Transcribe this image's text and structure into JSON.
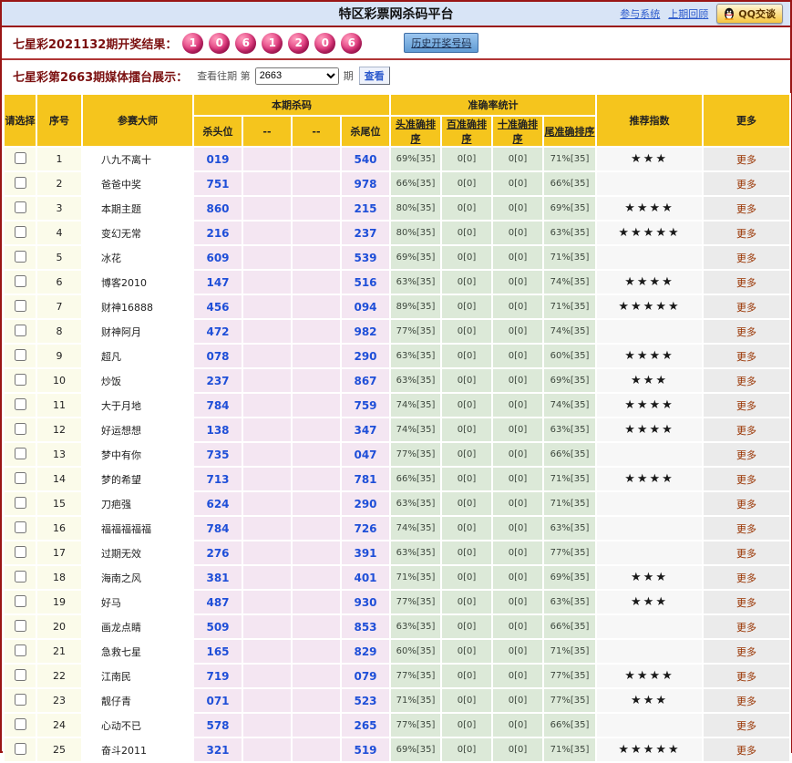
{
  "header": {
    "title": "特区彩票网杀码平台",
    "links": [
      "参与系统",
      "上期回顾"
    ],
    "qq_button_label": "QQ交谈"
  },
  "result_bar": {
    "label": "七星彩2021132期开奖结果：",
    "balls": [
      "1",
      "0",
      "6",
      "1",
      "2",
      "0",
      "6"
    ],
    "history_link": "历史开奖号码"
  },
  "picker_bar": {
    "label": "七星彩第2663期媒体擂台展示：",
    "hint": "查看往期 第",
    "selected_period": "2663",
    "suffix": "期",
    "view_button": "查看"
  },
  "table": {
    "group_headers": {
      "select": "请选择",
      "index": "序号",
      "master": "参赛大师",
      "kill": "本期杀码",
      "accuracy": "准确率统计",
      "stars": "推荐指数",
      "more": "更多"
    },
    "kill_subheaders": [
      "杀头位",
      "--",
      "--",
      "杀尾位"
    ],
    "accuracy_subheaders": [
      "头准确排序",
      "百准确排序",
      "十准确排序",
      "尾准确排序"
    ],
    "more_label": "更多",
    "star_glyph": "★",
    "rows": [
      {
        "index": 1,
        "master": "八九不离十",
        "head": "019",
        "tail": "540",
        "acc": [
          "69%[35]",
          "0[0]",
          "0[0]",
          "71%[35]"
        ],
        "stars": 3
      },
      {
        "index": 2,
        "master": "爸爸中奖",
        "head": "751",
        "tail": "978",
        "acc": [
          "66%[35]",
          "0[0]",
          "0[0]",
          "66%[35]"
        ],
        "stars": 0
      },
      {
        "index": 3,
        "master": "本期主题",
        "head": "860",
        "tail": "215",
        "acc": [
          "80%[35]",
          "0[0]",
          "0[0]",
          "69%[35]"
        ],
        "stars": 4
      },
      {
        "index": 4,
        "master": "变幻无常",
        "head": "216",
        "tail": "237",
        "acc": [
          "80%[35]",
          "0[0]",
          "0[0]",
          "63%[35]"
        ],
        "stars": 5
      },
      {
        "index": 5,
        "master": "冰花",
        "head": "609",
        "tail": "539",
        "acc": [
          "69%[35]",
          "0[0]",
          "0[0]",
          "71%[35]"
        ],
        "stars": 0
      },
      {
        "index": 6,
        "master": "博客2010",
        "head": "147",
        "tail": "516",
        "acc": [
          "63%[35]",
          "0[0]",
          "0[0]",
          "74%[35]"
        ],
        "stars": 4
      },
      {
        "index": 7,
        "master": "财神16888",
        "head": "456",
        "tail": "094",
        "acc": [
          "89%[35]",
          "0[0]",
          "0[0]",
          "71%[35]"
        ],
        "stars": 5
      },
      {
        "index": 8,
        "master": "财神阿月",
        "head": "472",
        "tail": "982",
        "acc": [
          "77%[35]",
          "0[0]",
          "0[0]",
          "74%[35]"
        ],
        "stars": 0
      },
      {
        "index": 9,
        "master": "超凡",
        "head": "078",
        "tail": "290",
        "acc": [
          "63%[35]",
          "0[0]",
          "0[0]",
          "60%[35]"
        ],
        "stars": 4
      },
      {
        "index": 10,
        "master": "炒饭",
        "head": "237",
        "tail": "867",
        "acc": [
          "63%[35]",
          "0[0]",
          "0[0]",
          "69%[35]"
        ],
        "stars": 3
      },
      {
        "index": 11,
        "master": "大于月地",
        "head": "784",
        "tail": "759",
        "acc": [
          "74%[35]",
          "0[0]",
          "0[0]",
          "74%[35]"
        ],
        "stars": 4
      },
      {
        "index": 12,
        "master": "好运想想",
        "head": "138",
        "tail": "347",
        "acc": [
          "74%[35]",
          "0[0]",
          "0[0]",
          "63%[35]"
        ],
        "stars": 4
      },
      {
        "index": 13,
        "master": "梦中有你",
        "head": "735",
        "tail": "047",
        "acc": [
          "77%[35]",
          "0[0]",
          "0[0]",
          "66%[35]"
        ],
        "stars": 0
      },
      {
        "index": 14,
        "master": "梦的希望",
        "head": "713",
        "tail": "781",
        "acc": [
          "66%[35]",
          "0[0]",
          "0[0]",
          "71%[35]"
        ],
        "stars": 4
      },
      {
        "index": 15,
        "master": "刀疤强",
        "head": "624",
        "tail": "290",
        "acc": [
          "63%[35]",
          "0[0]",
          "0[0]",
          "71%[35]"
        ],
        "stars": 0
      },
      {
        "index": 16,
        "master": "福福福福福",
        "head": "784",
        "tail": "726",
        "acc": [
          "74%[35]",
          "0[0]",
          "0[0]",
          "63%[35]"
        ],
        "stars": 0
      },
      {
        "index": 17,
        "master": "过期无效",
        "head": "276",
        "tail": "391",
        "acc": [
          "63%[35]",
          "0[0]",
          "0[0]",
          "77%[35]"
        ],
        "stars": 0
      },
      {
        "index": 18,
        "master": "海南之风",
        "head": "381",
        "tail": "401",
        "acc": [
          "71%[35]",
          "0[0]",
          "0[0]",
          "69%[35]"
        ],
        "stars": 3
      },
      {
        "index": 19,
        "master": "好马",
        "head": "487",
        "tail": "930",
        "acc": [
          "77%[35]",
          "0[0]",
          "0[0]",
          "63%[35]"
        ],
        "stars": 3
      },
      {
        "index": 20,
        "master": "画龙点睛",
        "head": "509",
        "tail": "853",
        "acc": [
          "63%[35]",
          "0[0]",
          "0[0]",
          "66%[35]"
        ],
        "stars": 0
      },
      {
        "index": 21,
        "master": "急救七星",
        "head": "165",
        "tail": "829",
        "acc": [
          "60%[35]",
          "0[0]",
          "0[0]",
          "71%[35]"
        ],
        "stars": 0
      },
      {
        "index": 22,
        "master": "江南民",
        "head": "719",
        "tail": "079",
        "acc": [
          "77%[35]",
          "0[0]",
          "0[0]",
          "77%[35]"
        ],
        "stars": 4
      },
      {
        "index": 23,
        "master": "靓仔青",
        "head": "071",
        "tail": "523",
        "acc": [
          "71%[35]",
          "0[0]",
          "0[0]",
          "77%[35]"
        ],
        "stars": 3
      },
      {
        "index": 24,
        "master": "心动不已",
        "head": "578",
        "tail": "265",
        "acc": [
          "77%[35]",
          "0[0]",
          "0[0]",
          "66%[35]"
        ],
        "stars": 0
      },
      {
        "index": 25,
        "master": "奋斗2011",
        "head": "321",
        "tail": "519",
        "acc": [
          "69%[35]",
          "0[0]",
          "0[0]",
          "71%[35]"
        ],
        "stars": 5
      }
    ]
  },
  "colors": {
    "border_maroon": "#9a1515",
    "titlebar_bg": "#d8e4f6",
    "header_yellow": "#f5c51d",
    "ball_pink": "#e23c80",
    "kill_cell_bg": "#f4e6f2",
    "accuracy_cell_bg": "#dce9d8",
    "kill_number_blue": "#1f4fd8",
    "section_label_maroon": "#7b1010",
    "more_link_color": "#993300"
  }
}
